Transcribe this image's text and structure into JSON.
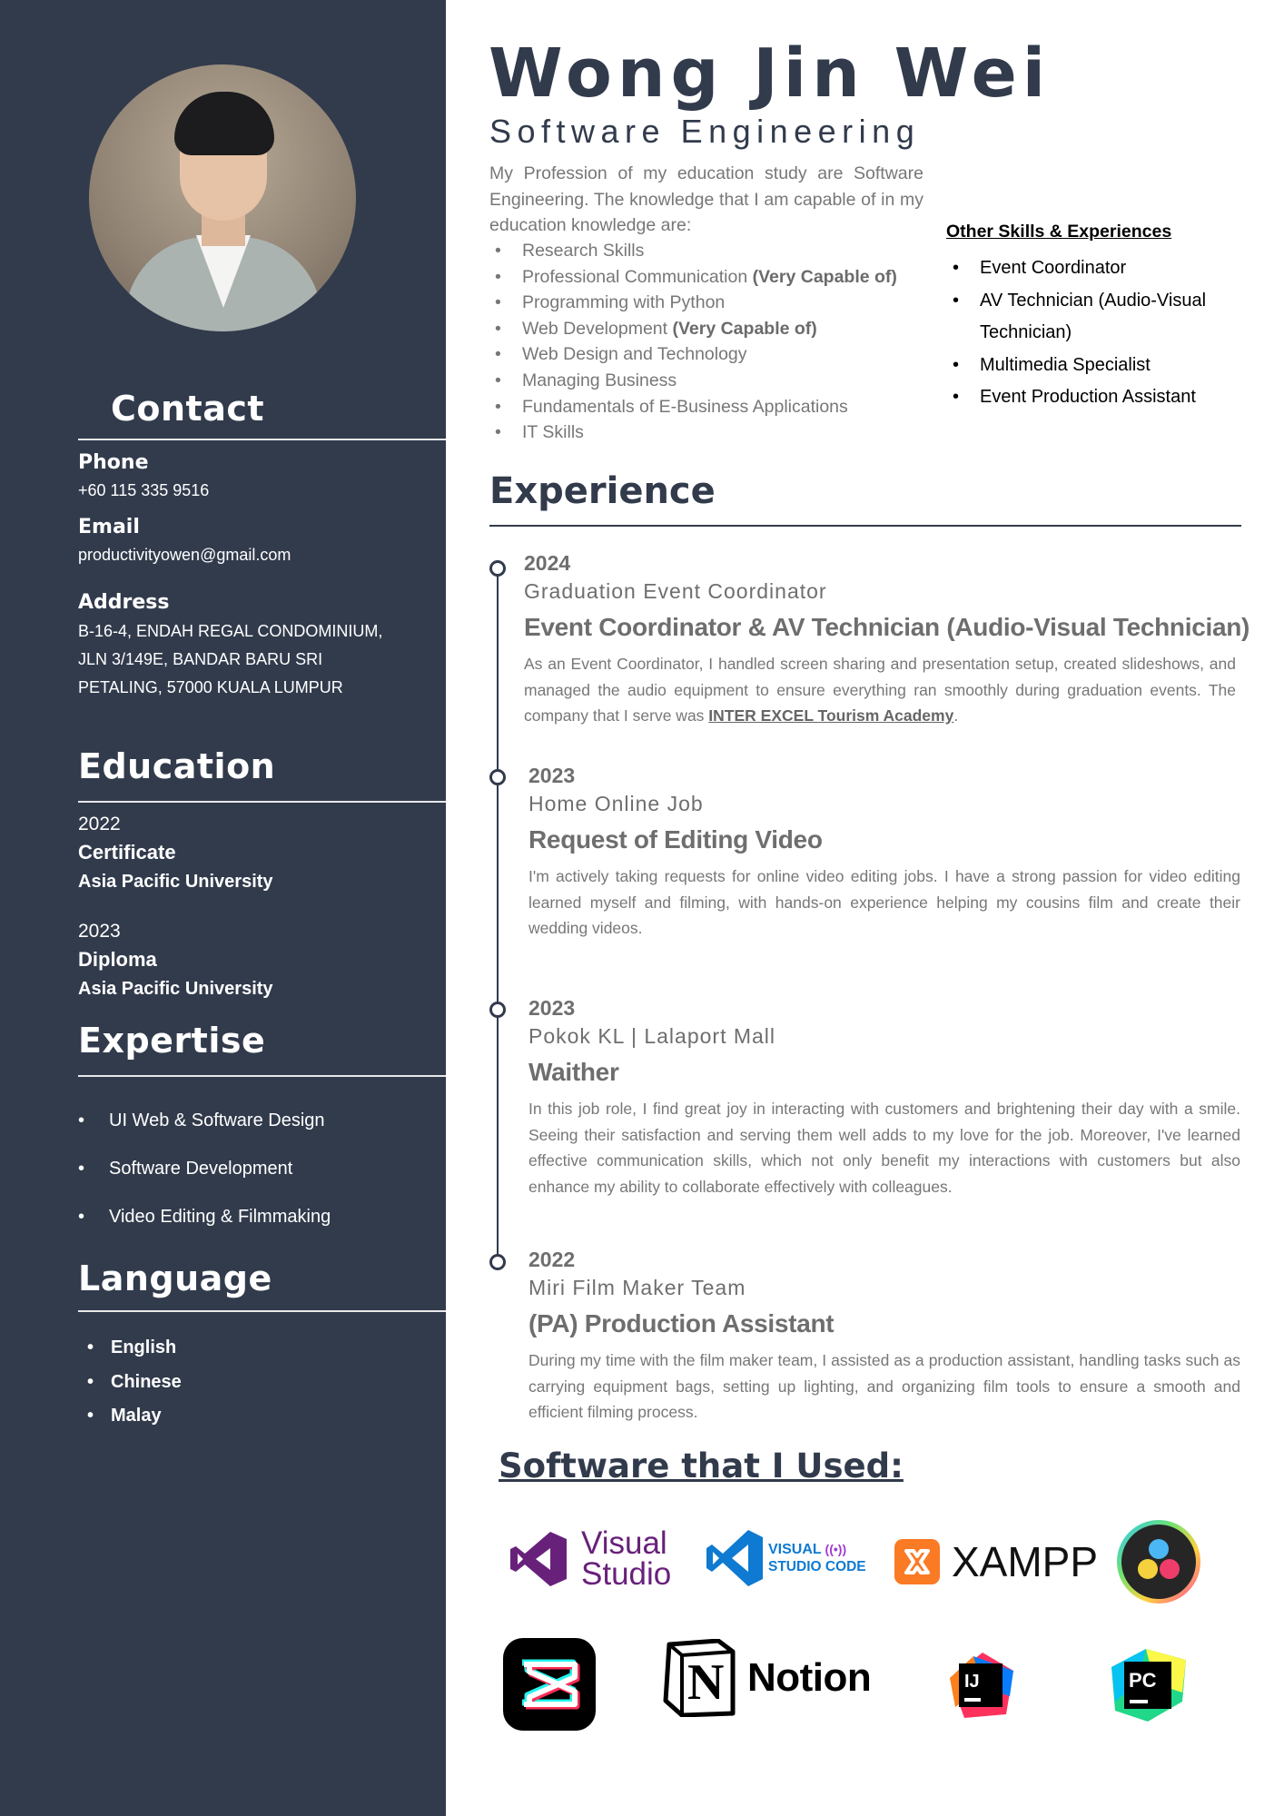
{
  "profile": {
    "name": "Wong Jin Wei",
    "role": "Software Engineering",
    "intro": "My Profession of my education study are Software Engineering. The knowledge that I am capable of in my education knowledge are:",
    "skills": [
      {
        "text": "Research Skills",
        "note": ""
      },
      {
        "text": "Professional Communication ",
        "note": "(Very Capable of)"
      },
      {
        "text": "Programming with Python",
        "note": ""
      },
      {
        "text": "Web Development  ",
        "note": "(Very Capable of)"
      },
      {
        "text": "Web Design and Technology",
        "note": ""
      },
      {
        "text": "Managing Business",
        "note": ""
      },
      {
        "text": "Fundamentals of E-Business Applications",
        "note": ""
      },
      {
        "text": "IT Skills",
        "note": ""
      }
    ]
  },
  "other": {
    "heading": "Other Skills & Experiences",
    "items": [
      "Event Coordinator",
      "AV Technician (Audio-Visual Technician)",
      "Multimedia Specialist",
      "Event Production Assistant"
    ]
  },
  "contact": {
    "heading": "Contact",
    "phone_label": "Phone",
    "phone": "+60 115 335 9516",
    "email_label": "Email",
    "email": "productivityowen@gmail.com",
    "address_label": "Address",
    "address_lines": [
      "B-16-4, ENDAH REGAL CONDOMINIUM,",
      "JLN 3/149E, BANDAR BARU SRI",
      "PETALING, 57000 KUALA LUMPUR"
    ]
  },
  "education": {
    "heading": "Education",
    "items": [
      {
        "year": "2022",
        "degree": "Certificate",
        "school": "Asia Pacific University"
      },
      {
        "year": "2023",
        "degree": "Diploma",
        "school": "Asia Pacific University"
      }
    ]
  },
  "expertise": {
    "heading": "Expertise",
    "items": [
      "UI Web & Software Design",
      "Software Development",
      "Video Editing & Filmmaking"
    ]
  },
  "language": {
    "heading": "Language",
    "items": [
      "English",
      "Chinese",
      "Malay"
    ]
  },
  "experience": {
    "heading": "Experience",
    "jobs": [
      {
        "year": "2024",
        "company": "Graduation Event Coordinator",
        "title": "Event Coordinator & AV Technician (Audio-Visual Technician)",
        "desc": "As an Event Coordinator, I handled screen sharing and presentation setup, created slideshows, and managed the audio equipment to ensure everything ran smoothly during graduation events. The company that I serve was ",
        "link": "INTER EXCEL Tourism Academy",
        "desc_end": "."
      },
      {
        "year": "2023",
        "company": "Home Online Job",
        "title": "Request of Editing Video",
        "desc": "I'm actively taking requests for online video editing jobs. I have a strong passion for video editing learned myself and filming, with hands-on experience helping my cousins film and create their wedding videos."
      },
      {
        "year": "2023",
        "company": "Pokok KL | Lalaport Mall",
        "title": "Waither",
        "desc": "In this job role, I find great joy in interacting with customers and brightening their day with a smile. Seeing their satisfaction and serving them well adds to my love for the job. Moreover, I've learned effective communication skills, which not only benefit my interactions with customers but also enhance my ability to collaborate effectively with colleagues."
      },
      {
        "year": "2022",
        "company": "Miri Film Maker Team",
        "title": "(PA) Production Assistant",
        "desc": "During my time with the film maker team, I assisted as a production assistant, handling tasks such as carrying equipment bags, setting up lighting, and organizing film tools to ensure a smooth and efficient filming process."
      }
    ]
  },
  "software": {
    "heading": "Software that I Used:",
    "logos": {
      "vs_line1": "Visual",
      "vs_line2": "Studio",
      "vscode_line1": "VISUAL",
      "vscode_line2": "STUDIO CODE",
      "xampp": "XAMPP",
      "notion": "Notion",
      "notion_mark": "N",
      "intellij": "IJ",
      "pycharm": "PC"
    }
  },
  "colors": {
    "sidebar": "#323b4c",
    "vs_purple": "#68217a",
    "vscode_blue": "#0e7ad1",
    "xampp_orange": "#fb7a24"
  }
}
